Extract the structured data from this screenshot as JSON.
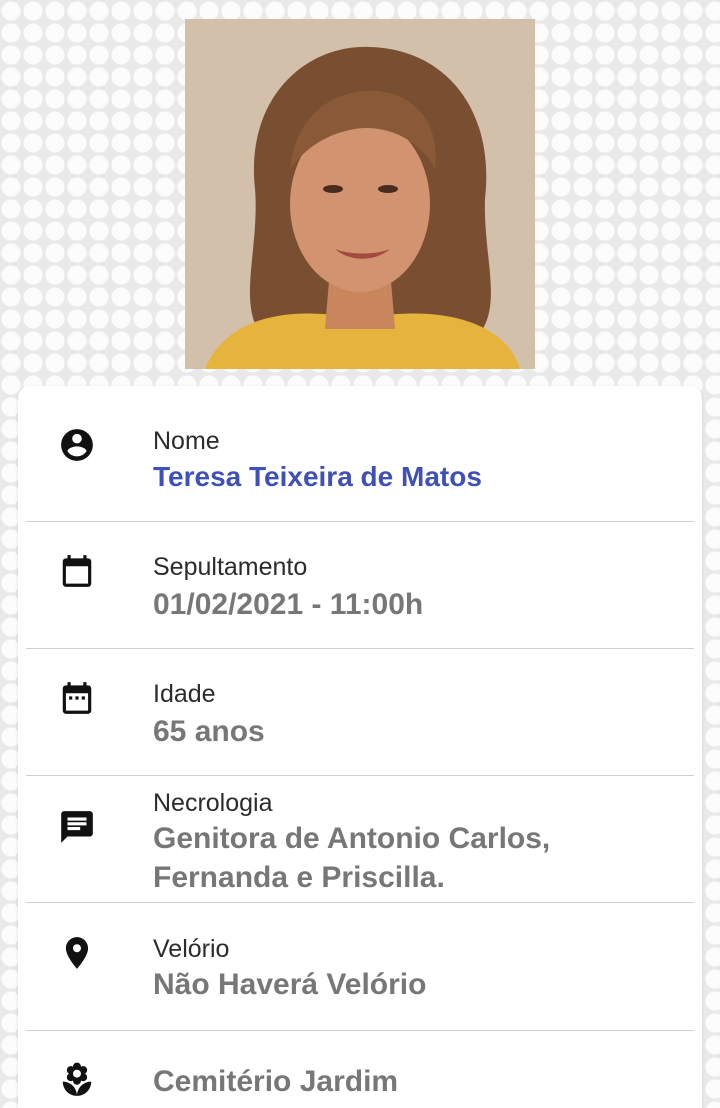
{
  "colors": {
    "name_accent": "#3f51b5",
    "value_gray": "#777777",
    "label_dark": "#2b2b2b",
    "divider": "#cfcfcf",
    "background": "#e9e9e9"
  },
  "photo": {
    "icon": "portrait-photo"
  },
  "rows": [
    {
      "icon": "account-circle-icon",
      "label": "Nome",
      "value": "Teresa Teixeira de Matos"
    },
    {
      "icon": "calendar-icon",
      "label": "Sepultamento",
      "value": "01/02/2021 - 11:00h"
    },
    {
      "icon": "calendar-dots-icon",
      "label": "Idade",
      "value": "65 anos"
    },
    {
      "icon": "message-icon",
      "label": "Necrologia",
      "value_lines": [
        "Genitora de Antonio Carlos,",
        "Fernanda e Priscilla."
      ]
    },
    {
      "icon": "map-pin-icon",
      "label": "Velório",
      "value": "Não Haverá Velório"
    },
    {
      "icon": "flower-icon",
      "value": "Cemitério Jardim"
    }
  ]
}
